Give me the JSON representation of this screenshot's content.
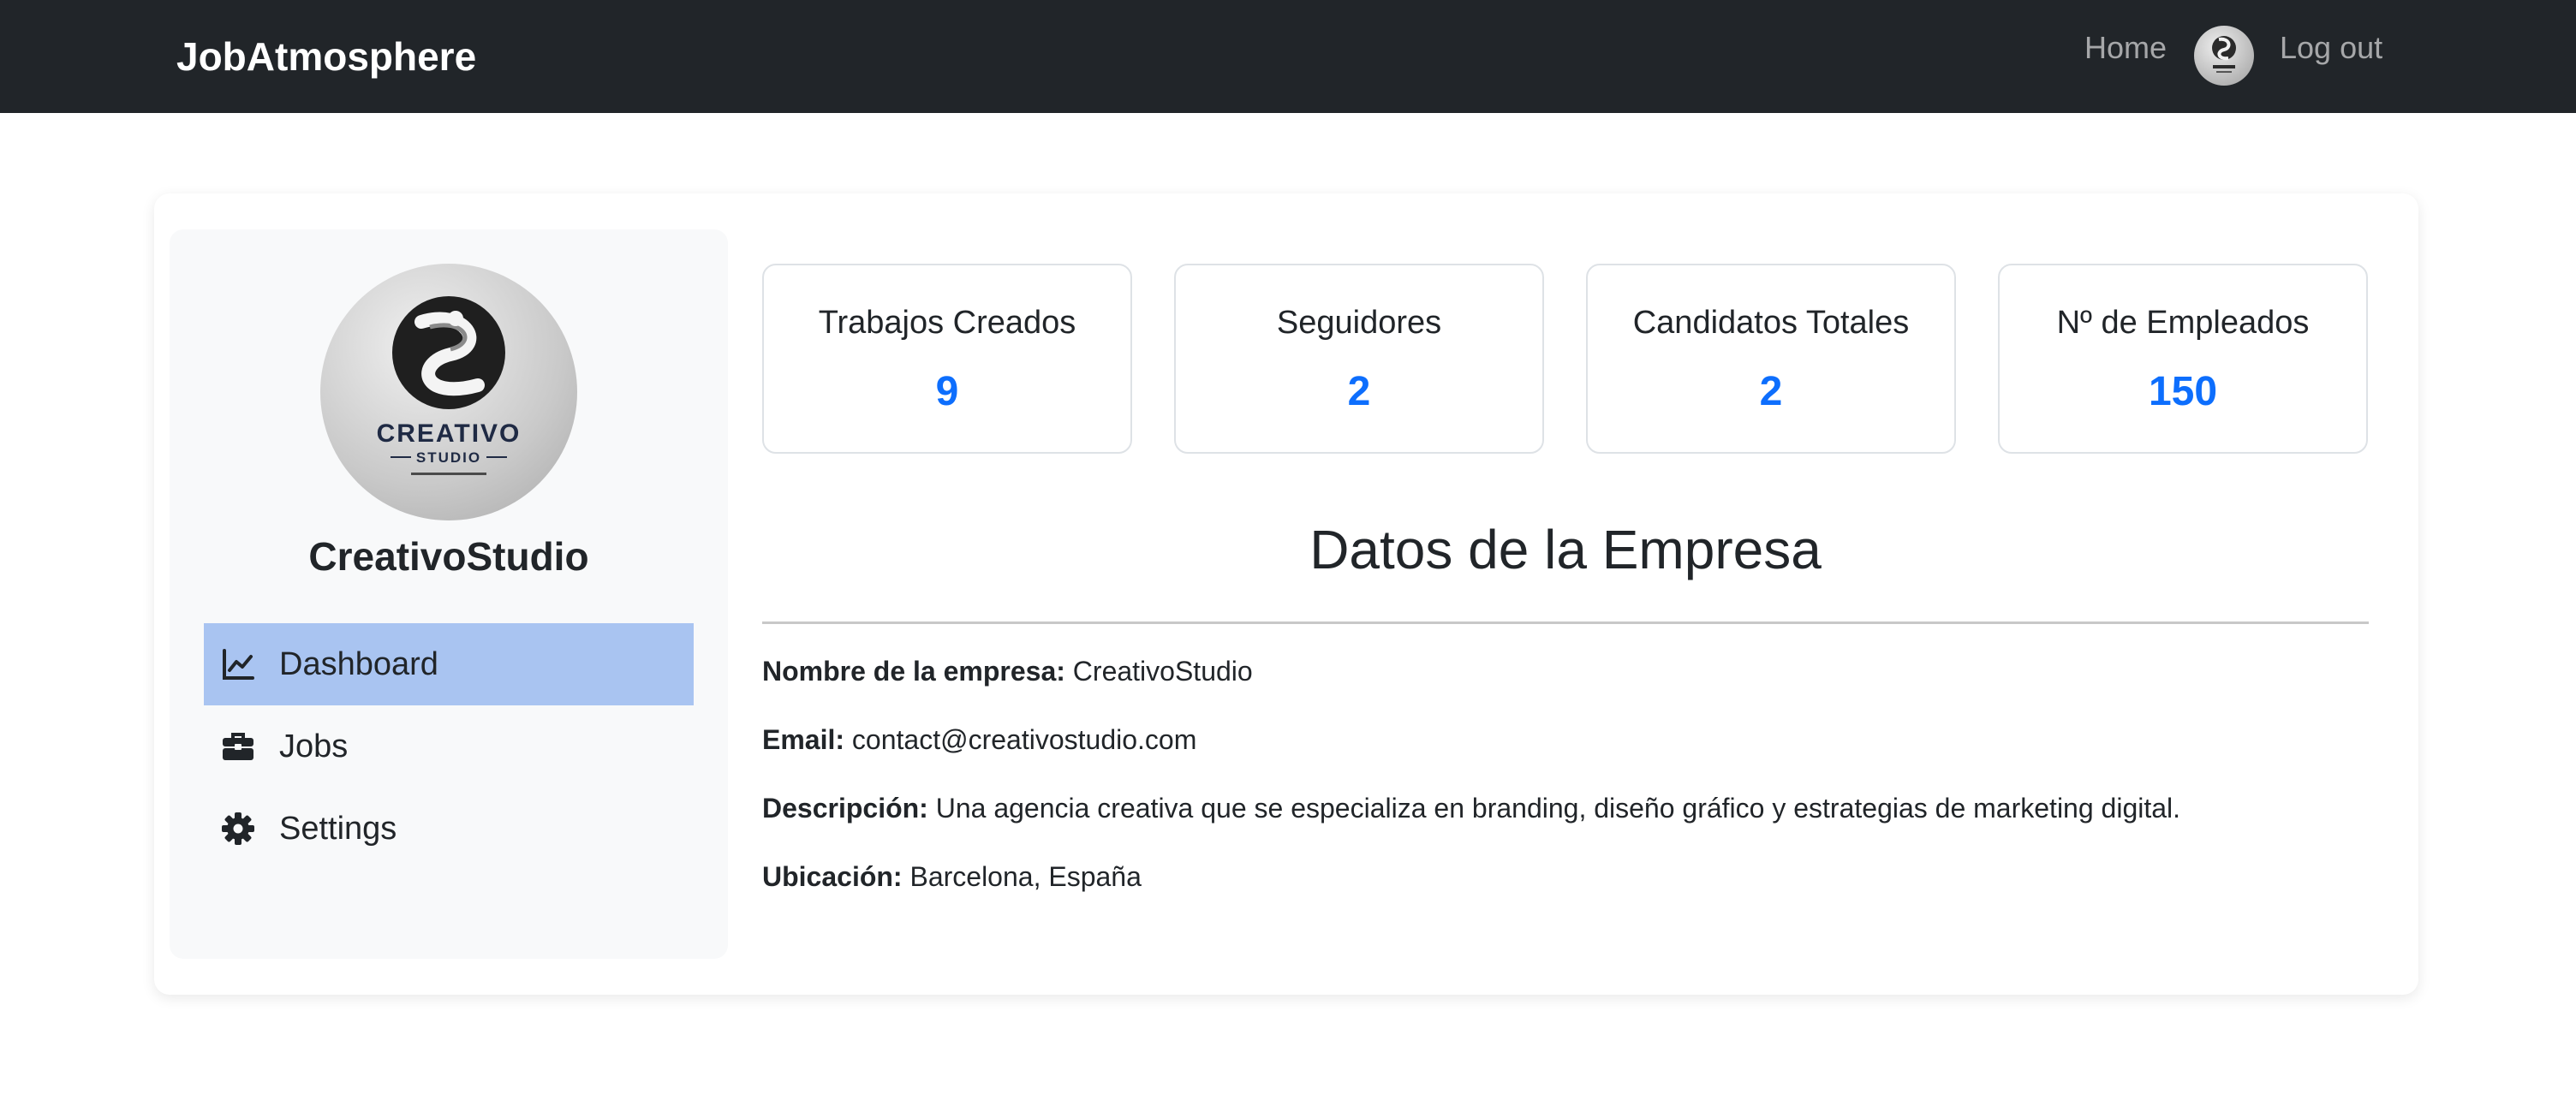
{
  "navbar": {
    "brand": "JobAtmosphere",
    "home_label": "Home",
    "logout_label": "Log out"
  },
  "sidebar": {
    "company_name": "CreativoStudio",
    "logo_text": "CREATIVO",
    "logo_subtext": "STUDIO",
    "items": [
      {
        "label": "Dashboard",
        "icon": "chart-line-icon",
        "active": true
      },
      {
        "label": "Jobs",
        "icon": "briefcase-icon",
        "active": false
      },
      {
        "label": "Settings",
        "icon": "gear-icon",
        "active": false
      }
    ]
  },
  "stats": [
    {
      "label": "Trabajos Creados",
      "value": "9"
    },
    {
      "label": "Seguidores",
      "value": "2"
    },
    {
      "label": "Candidatos Totales",
      "value": "2"
    },
    {
      "label": "Nº de Empleados",
      "value": "150"
    }
  ],
  "company_data": {
    "title": "Datos de la Empresa",
    "fields": [
      {
        "label": "Nombre de la empresa:",
        "value": "CreativoStudio"
      },
      {
        "label": "Email:",
        "value": "contact@creativostudio.com"
      },
      {
        "label": "Descripción:",
        "value": "Una agencia creativa que se especializa en branding, diseño gráfico y estrategias de marketing digital."
      },
      {
        "label": "Ubicación:",
        "value": "Barcelona, España"
      }
    ]
  },
  "colors": {
    "navbar_bg": "#212529",
    "accent": "#0d6efd",
    "active_nav_bg": "#a9c4f1"
  }
}
